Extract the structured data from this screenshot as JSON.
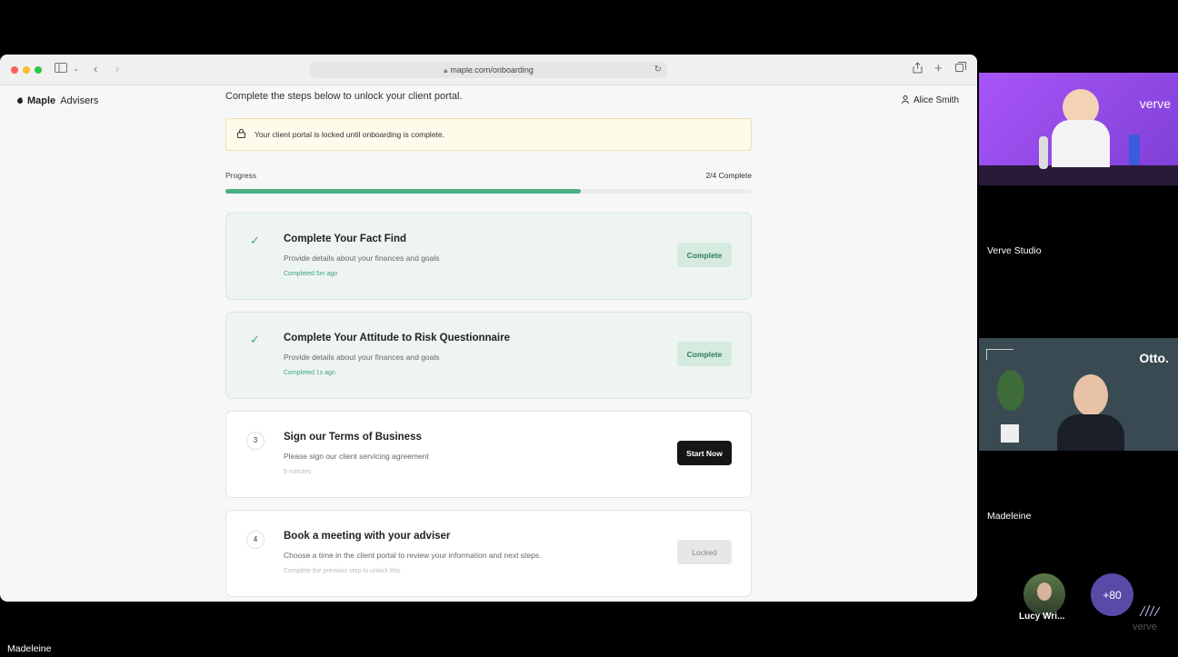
{
  "browser": {
    "url": "maple.com/onboarding",
    "colors": {
      "close": "#ff5f57",
      "minimize": "#febc2e",
      "maximize": "#28c840"
    }
  },
  "header": {
    "logo_bold": "Maple",
    "logo_rest": "Advisers",
    "user_name": "Alice Smith"
  },
  "intro": "Complete the steps below to unlock your client portal.",
  "notice": "Your client portal is locked until onboarding is complete.",
  "progress": {
    "label": "Progress",
    "count_text": "2/4 Complete",
    "fraction": 0.675,
    "color": "#4caf85"
  },
  "steps": [
    {
      "status": "complete",
      "title": "Complete Your Fact Find",
      "description": "Provide details about your finances and goals",
      "sub": "Completed 5m ago",
      "button": "Complete"
    },
    {
      "status": "complete",
      "title": "Complete Your Attitude to Risk Questionnaire",
      "description": "Provide details about your finances and goals",
      "sub": "Completed 1s ago",
      "button": "Complete"
    },
    {
      "status": "active",
      "number": "3",
      "title": "Sign our Terms of Business",
      "description": "Please sign our client servicing agreement",
      "sub": "5 minutes",
      "button": "Start Now"
    },
    {
      "status": "locked",
      "number": "4",
      "title": "Book a meeting with your adviser",
      "description": "Choose a time in the client portal to review your information and next steps.",
      "sub": "Complete the previous step to unlock this.",
      "button": "Locked"
    }
  ],
  "participants": {
    "studio_name": "Verve Studio",
    "studio_brand": "verve",
    "madeleine_name": "Madeleine",
    "madeleine_brand": "Otto.",
    "lucy_name": "Lucy Wri...",
    "extra_count": "+80",
    "corner_brand": "verve",
    "presenter_name": "Madeleine"
  }
}
